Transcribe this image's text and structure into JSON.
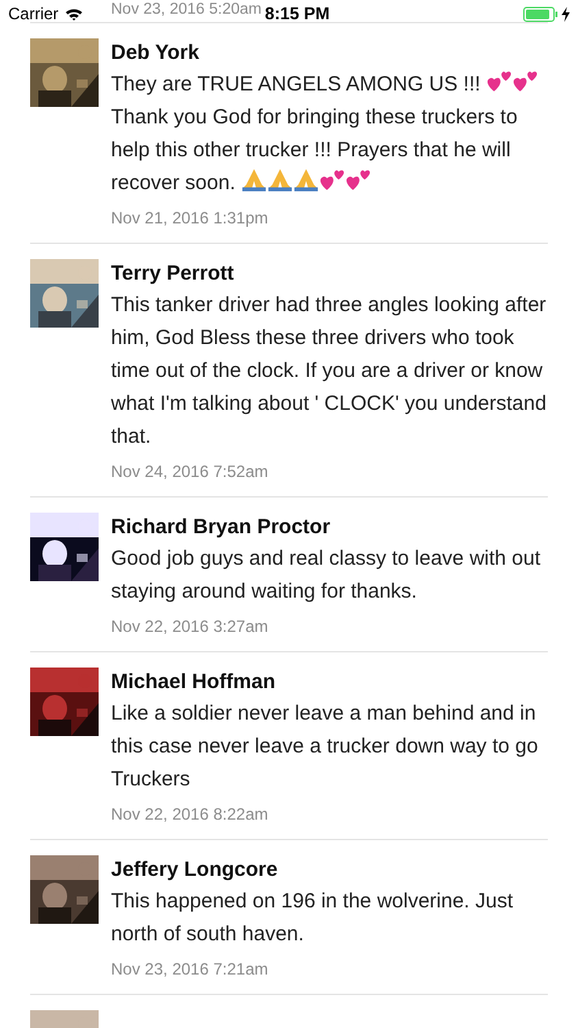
{
  "status_bar": {
    "carrier": "Carrier",
    "time": "8:15 PM",
    "charging": true
  },
  "comments": [
    {
      "kind": "date_only",
      "date": "Nov 23, 2016 5:20am"
    },
    {
      "name": "Deb York",
      "date": "Nov 21, 2016 1:31pm",
      "body": [
        {
          "kind": "text",
          "text": "They are TRUE ANGELS AMONG US !!! "
        },
        {
          "kind": "hearts"
        },
        {
          "kind": "hearts"
        },
        {
          "kind": "text",
          "text": " Thank you God for bringing these truckers to help this other trucker !!! Prayers that he will recover soon. "
        },
        {
          "kind": "hands"
        },
        {
          "kind": "hands"
        },
        {
          "kind": "hands"
        },
        {
          "kind": "hearts"
        },
        {
          "kind": "hearts"
        }
      ]
    },
    {
      "name": "Terry Perrott",
      "date": "Nov 24, 2016 7:52am",
      "body": [
        {
          "kind": "text",
          "text": "This tanker driver had three angles looking after him, God Bless these three drivers who took time out of the clock. If you are a driver or know what I'm talking about ' CLOCK' you understand that."
        }
      ]
    },
    {
      "name": "Richard Bryan Proctor",
      "date": "Nov 22, 2016 3:27am",
      "body": [
        {
          "kind": "text",
          "text": "Good job guys and real classy to leave with out staying around waiting for thanks."
        }
      ]
    },
    {
      "name": "Michael Hoffman",
      "date": "Nov 22, 2016 8:22am",
      "body": [
        {
          "kind": "text",
          "text": "Like a soldier never leave a man behind and in this case never leave a trucker down way to go Truckers"
        }
      ]
    },
    {
      "name": "Jeffery Longcore",
      "date": "Nov 23, 2016 7:21am",
      "body": [
        {
          "kind": "text",
          "text": "This happened on 196 in the wolverine. Just north of south haven."
        }
      ]
    },
    {
      "kind": "avatar_only"
    }
  ]
}
